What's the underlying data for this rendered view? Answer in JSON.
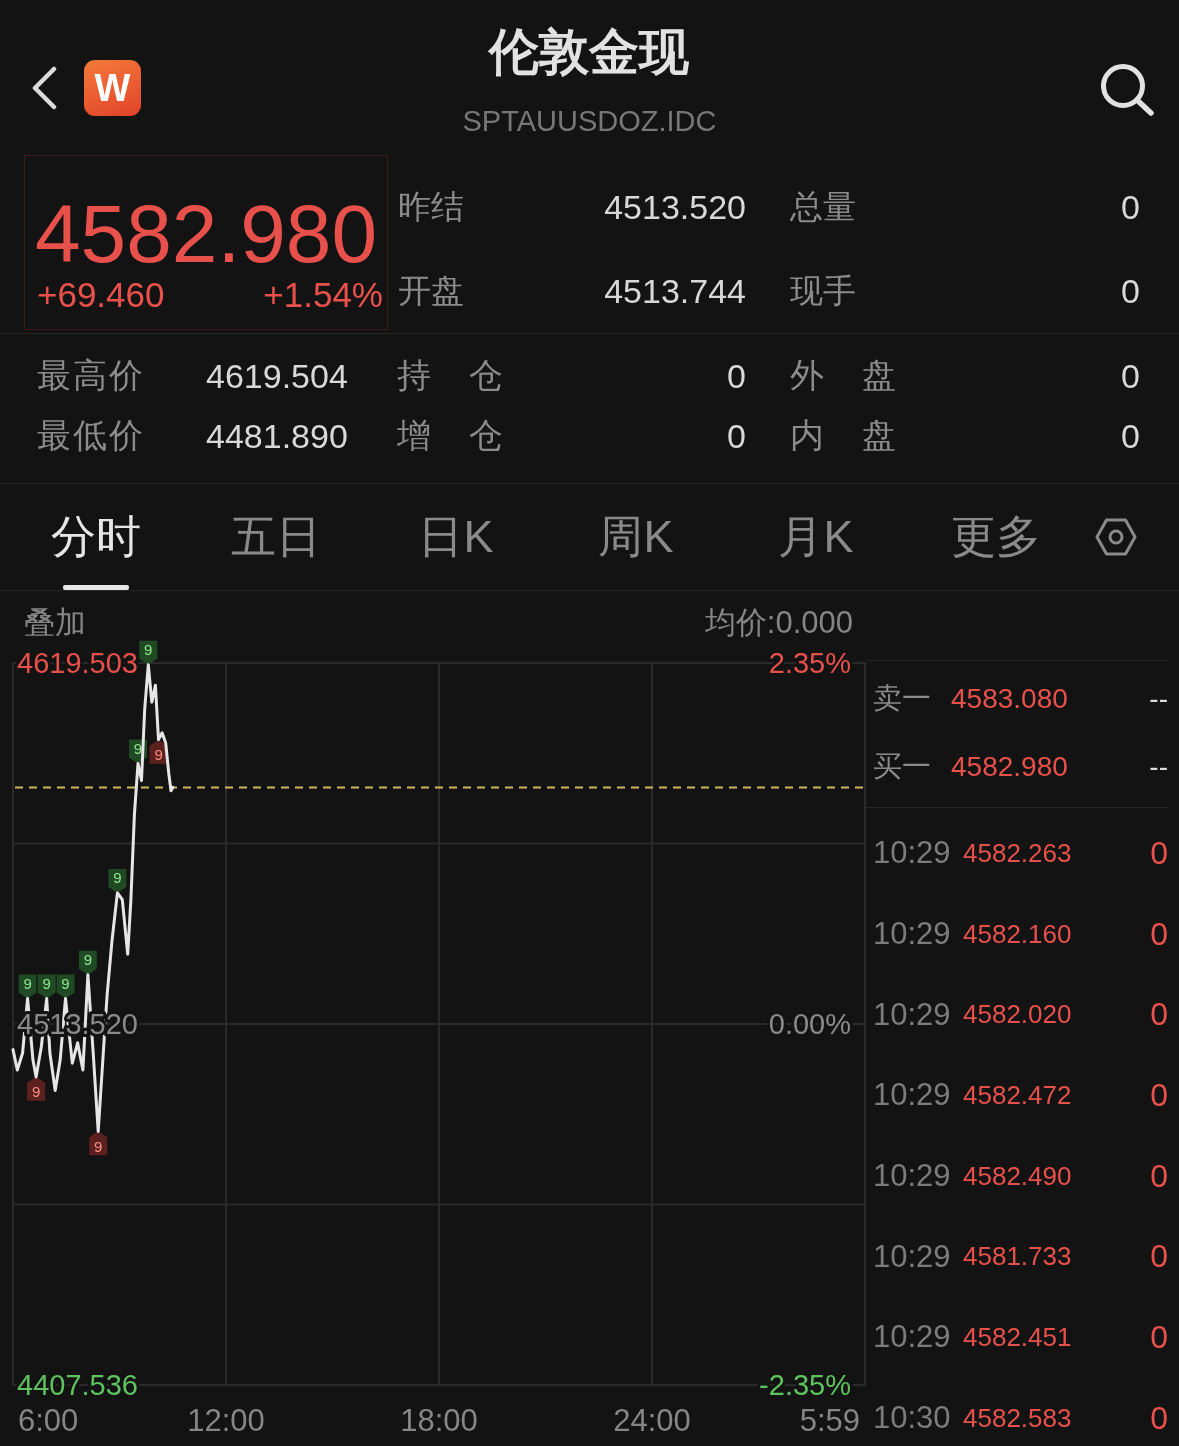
{
  "header": {
    "title": "伦敦金现",
    "symbol": "SPTAUUSDOZ.IDC",
    "logo": "W"
  },
  "quote": {
    "price": "4582.980",
    "change": "+69.460",
    "change_percent": "+1.54%",
    "stats": [
      {
        "label": "昨结",
        "value": "4513.520"
      },
      {
        "label": "总量",
        "value": "0"
      },
      {
        "label": "开盘",
        "value": "4513.744"
      },
      {
        "label": "现手",
        "value": "0"
      }
    ]
  },
  "details": [
    {
      "label": "最高价",
      "value": "4619.504"
    },
    {
      "label": "持 仓",
      "value": "0"
    },
    {
      "label": "外 盘",
      "value": "0"
    },
    {
      "label": "最低价",
      "value": "4481.890"
    },
    {
      "label": "增 仓",
      "value": "0"
    },
    {
      "label": "内 盘",
      "value": "0"
    }
  ],
  "tabs": [
    {
      "label": "分时",
      "selected": true
    },
    {
      "label": "五日",
      "selected": false
    },
    {
      "label": "日K",
      "selected": false
    },
    {
      "label": "周K",
      "selected": false
    },
    {
      "label": "月K",
      "selected": false
    },
    {
      "label": "更多",
      "selected": false
    }
  ],
  "chart_header": {
    "overlay": "叠加",
    "average_price": "均价:0.000"
  },
  "chart": {
    "percent_labels": [
      "2.35%",
      "0.00%",
      "-2.35%"
    ],
    "end_time_label": "5:59",
    "signal_markers": [
      {
        "kind": "down"
      },
      {
        "kind": "down"
      },
      {
        "kind": "up"
      },
      {
        "kind": "down"
      },
      {
        "kind": "down"
      },
      {
        "kind": "down"
      },
      {
        "kind": "down"
      },
      {
        "kind": "down"
      },
      {
        "kind": "up"
      },
      {
        "kind": "up"
      }
    ],
    "chart_data": {
      "type": "line",
      "grid": true,
      "x": [
        6.0,
        6.12,
        6.27,
        6.41,
        6.56,
        6.65,
        6.8,
        6.95,
        7.04,
        7.19,
        7.33,
        7.48,
        7.67,
        7.82,
        7.97,
        8.11,
        8.26,
        8.4,
        8.55,
        8.65,
        8.79,
        8.94,
        9.08,
        9.23,
        9.32,
        9.42,
        9.52,
        9.62,
        9.71,
        9.81,
        9.91,
        10.01,
        10.1,
        10.2,
        10.3,
        10.39,
        10.45,
        10.5
      ],
      "values": [
        4506,
        4500,
        4505,
        4521,
        4503,
        4498,
        4507,
        4521,
        4505,
        4494,
        4503,
        4521,
        4502,
        4508,
        4500,
        4528,
        4505,
        4482,
        4506,
        4522,
        4538,
        4552,
        4550,
        4534,
        4550,
        4575,
        4590,
        4585,
        4606,
        4619,
        4608,
        4613,
        4597,
        4599,
        4596,
        4587,
        4582,
        4583
      ],
      "xlim": [
        6,
        30
      ],
      "ylim": [
        4407.536,
        4619.503
      ],
      "xticks": [
        {
          "value": 6,
          "label": "6:00"
        },
        {
          "value": 12,
          "label": "12:00"
        },
        {
          "value": 18,
          "label": "18:00"
        },
        {
          "value": 24,
          "label": "24:00"
        }
      ],
      "yticks": [
        {
          "value": 4619.503,
          "label": "4619.503"
        },
        {
          "value": 4513.52,
          "label": "4513.520"
        },
        {
          "value": 4407.536,
          "label": "4407.536"
        }
      ],
      "ref_lines": [
        {
          "axis": "y",
          "value": 4582.98
        }
      ],
      "annotations": [
        {
          "text": "9",
          "x": 9.81,
          "y": 4619
        },
        {
          "text": "9",
          "x": 9.52,
          "y": 4590
        },
        {
          "text": "9",
          "x": 10.1,
          "y": 4597
        },
        {
          "text": "9",
          "x": 8.94,
          "y": 4552
        },
        {
          "text": "9",
          "x": 6.41,
          "y": 4521
        },
        {
          "text": "9",
          "x": 6.95,
          "y": 4521
        },
        {
          "text": "9",
          "x": 7.48,
          "y": 4521
        },
        {
          "text": "9",
          "x": 8.11,
          "y": 4528
        },
        {
          "text": "9",
          "x": 6.65,
          "y": 4498
        },
        {
          "text": "9",
          "x": 8.4,
          "y": 4482
        }
      ]
    }
  },
  "order_book": [
    {
      "label": "卖一",
      "price": "4583.080",
      "volume": "--"
    },
    {
      "label": "买一",
      "price": "4582.980",
      "volume": "--"
    }
  ],
  "trades": [
    {
      "time": "10:29",
      "price": "4582.263",
      "volume": "0"
    },
    {
      "time": "10:29",
      "price": "4582.160",
      "volume": "0"
    },
    {
      "time": "10:29",
      "price": "4582.020",
      "volume": "0"
    },
    {
      "time": "10:29",
      "price": "4582.472",
      "volume": "0"
    },
    {
      "time": "10:29",
      "price": "4582.490",
      "volume": "0"
    },
    {
      "time": "10:29",
      "price": "4581.733",
      "volume": "0"
    },
    {
      "time": "10:29",
      "price": "4582.451",
      "volume": "0"
    },
    {
      "time": "10:30",
      "price": "4582.583",
      "volume": "0"
    }
  ]
}
